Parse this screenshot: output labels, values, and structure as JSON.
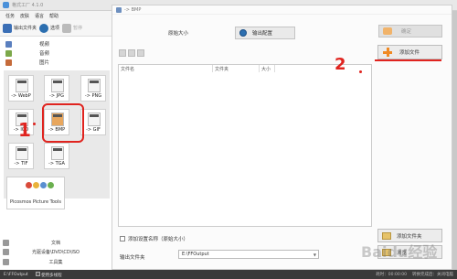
{
  "app": {
    "title": "格式工厂 4.1.0"
  },
  "menu": [
    "任务",
    "皮肤",
    "语言",
    "帮助"
  ],
  "toolbar": {
    "output_folder": "输出文件夹",
    "options": "选项",
    "stop": "暂停"
  },
  "sidebar": {
    "categories": [
      "视频",
      "音频",
      "图片"
    ],
    "formats": [
      "-> WebP",
      "-> JPG",
      "-> PNG",
      "-> ICO",
      "-> BMP",
      "-> GIF",
      "-> TIF",
      "-> TGA"
    ],
    "picosmos": "Picosmos Picture Tools",
    "bottom_categories": [
      "文档",
      "光驱设备\\DVD\\CD\\ISO",
      "工具集"
    ]
  },
  "statusbar": {
    "output": "E:\\FFOutput",
    "multithread": "使用多线程",
    "elapsed": "耗时：00:00:00",
    "after_convert": "转换完成后：关闭电脑"
  },
  "dialog": {
    "title": "-> BMP",
    "quality_label": "原始大小",
    "output_config_button": "输出配置",
    "ok_button": "确定",
    "add_file_button": "添加文件",
    "columns": [
      "文件名",
      "文件夹",
      "大小"
    ],
    "add_setting_checkbox": "添加设置名称（原始大小）",
    "add_folder_button": "添加文件夹",
    "output_folder_label": "输出文件夹",
    "output_folder_value": "E:\\FFOutput",
    "browse_button": "浏览"
  },
  "annotations": {
    "step1": "1",
    "step2": "2"
  },
  "watermark": "Baidu经验",
  "colors": {
    "annotation_red": "#e0241f",
    "add_icon_orange": "#f08a24",
    "statusbar_bg": "#3a3a3a"
  }
}
